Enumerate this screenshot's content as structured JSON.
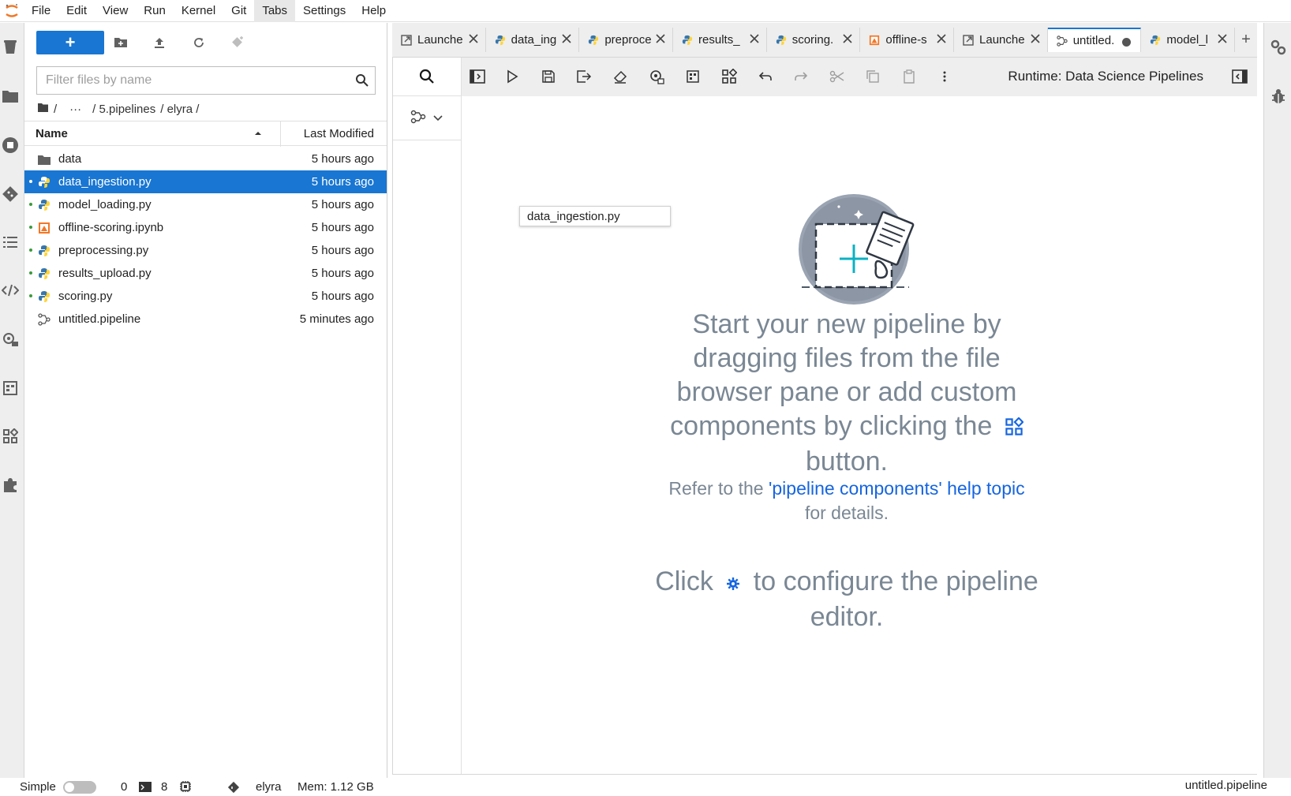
{
  "menu": [
    "File",
    "Edit",
    "View",
    "Run",
    "Kernel",
    "Git",
    "Tabs",
    "Settings",
    "Help"
  ],
  "file_browser": {
    "new_label": "+",
    "filter_placeholder": "Filter files by name",
    "breadcrumb": [
      "/",
      "···",
      "/ 5.pipelines",
      "/ elyra /"
    ],
    "col_name": "Name",
    "col_modified": "Last Modified",
    "files": [
      {
        "name": "data",
        "modified": "5 hours ago",
        "type": "folder",
        "selected": false
      },
      {
        "name": "data_ingestion.py",
        "modified": "5 hours ago",
        "type": "python",
        "selected": true
      },
      {
        "name": "model_loading.py",
        "modified": "5 hours ago",
        "type": "python",
        "selected": false
      },
      {
        "name": "offline-scoring.ipynb",
        "modified": "5 hours ago",
        "type": "notebook",
        "selected": false
      },
      {
        "name": "preprocessing.py",
        "modified": "5 hours ago",
        "type": "python",
        "selected": false
      },
      {
        "name": "results_upload.py",
        "modified": "5 hours ago",
        "type": "python",
        "selected": false
      },
      {
        "name": "scoring.py",
        "modified": "5 hours ago",
        "type": "python",
        "selected": false
      },
      {
        "name": "untitled.pipeline",
        "modified": "5 minutes ago",
        "type": "pipeline",
        "selected": false
      }
    ]
  },
  "tabs": [
    {
      "label": "Launche",
      "icon": "launcher"
    },
    {
      "label": "data_ing",
      "icon": "python"
    },
    {
      "label": "preproce",
      "icon": "python"
    },
    {
      "label": "results_",
      "icon": "python"
    },
    {
      "label": "scoring.",
      "icon": "python"
    },
    {
      "label": "offline-s",
      "icon": "notebook"
    },
    {
      "label": "Launche",
      "icon": "launcher"
    },
    {
      "label": "untitled.",
      "icon": "pipeline",
      "active": true,
      "dirty": true
    },
    {
      "label": "model_l",
      "icon": "python"
    }
  ],
  "editor": {
    "runtime": "Runtime: Data Science Pipelines",
    "drag_tooltip": "data_ingestion.py",
    "empty_line1": "Start your new pipeline by dragging files from the file browser pane or add custom components by clicking the",
    "empty_line2": "button.",
    "help_prefix": "Refer to the ",
    "help_link": "'pipeline components' help topic",
    "help_suffix": "for details.",
    "config_prefix": "Click",
    "config_suffix": "to configure the pipeline editor."
  },
  "status": {
    "mode": "Simple",
    "kernels": "0",
    "terminals": "8",
    "git_branch": "elyra",
    "memory": "Mem: 1.12 GB",
    "current_file": "untitled.pipeline"
  },
  "colors": {
    "accent": "#1976d2",
    "text_muted": "#7a8794",
    "link": "#1565e0",
    "jupyter_orange": "#f37726"
  }
}
